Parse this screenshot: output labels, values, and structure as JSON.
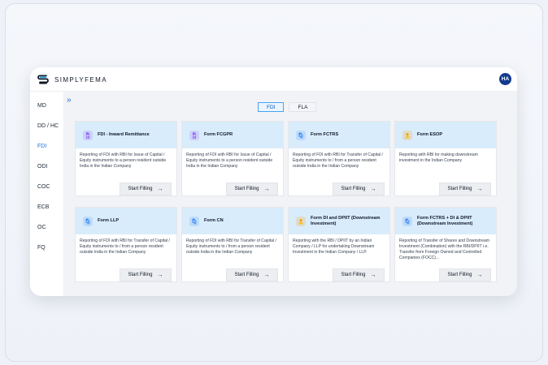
{
  "app": {
    "brand": "SIMPLYFEMA",
    "user_initials": "HA"
  },
  "sidebar": {
    "items": [
      {
        "label": "MD",
        "active": false
      },
      {
        "label": "DD / HC",
        "active": false
      },
      {
        "label": "FDI",
        "active": true
      },
      {
        "label": "ODI",
        "active": false
      },
      {
        "label": "COC",
        "active": false
      },
      {
        "label": "ECB",
        "active": false
      },
      {
        "label": "OC",
        "active": false
      },
      {
        "label": "FQ",
        "active": false
      }
    ]
  },
  "tabs": [
    {
      "label": "FDI",
      "active": true
    },
    {
      "label": "FLA",
      "active": false
    }
  ],
  "cards": [
    {
      "title": "FDI - Inward Remittance",
      "desc": "Reporting of FDI with RBI for Issue of Capital / Equity instruments to a person resident outside India in the Indian Company",
      "button": "Start Filling",
      "icon": "document-icon",
      "icon_color": "#8b5cf6"
    },
    {
      "title": "Form FCGPR",
      "desc": "Reporting of FDI with RBI for Issue of Capital / Equity instruments to a person resident outside India in the Indian Company",
      "button": "Start Filling",
      "icon": "document-icon",
      "icon_color": "#8b5cf6"
    },
    {
      "title": "Form FCTRS",
      "desc": "Reporting of FDI with RBI for Transfer of Capital / Equity instruments to / from a person resident outside India in the Indian Company",
      "button": "Start Filling",
      "icon": "transfer-icon",
      "icon_color": "#3b82f6"
    },
    {
      "title": "Form ESOP",
      "desc": "Reporting with RBI for making downstream investment in the Indian Company",
      "button": "Start Filling",
      "icon": "user-icon",
      "icon_color": "#f59e0b"
    },
    {
      "title": "Form LLP",
      "desc": "Reporting of FDI with RBI for Transfer of Capital / Equity instruments to / from a person resident outside India in the Indian Company",
      "button": "Start Filling",
      "icon": "transfer-icon",
      "icon_color": "#3b82f6"
    },
    {
      "title": "Form CN",
      "desc": "Reporting of FDI with RBI for Transfer of Capital / Equity instruments to / from a person resident outside India in the Indian Company",
      "button": "Start Filling",
      "icon": "transfer-icon",
      "icon_color": "#3b82f6"
    },
    {
      "title": "Form DI and DPIIT (Downstream Investment)",
      "desc": "Reporting with the RBI / DPIIT by an Indian Company / LLP for undertaking Downstream Investment in the Indian Company / LLP.",
      "button": "Start Filling",
      "icon": "user-icon",
      "icon_color": "#f59e0b"
    },
    {
      "title": "Form FCTRS + DI & DPIIT (Downstream Investment)",
      "desc": "Reporting of Transfer of Shares and Downstream Investment (Combination) with the RBI/DPIIT i.e. Transfer from Foreign Owned and Controlled Companies (FOCC)...",
      "button": "Start Filling",
      "icon": "transfer-icon",
      "icon_color": "#3b82f6"
    }
  ],
  "icons": {
    "collapse": "double-chevron-right-icon",
    "arrow": "arrow-right-icon"
  }
}
